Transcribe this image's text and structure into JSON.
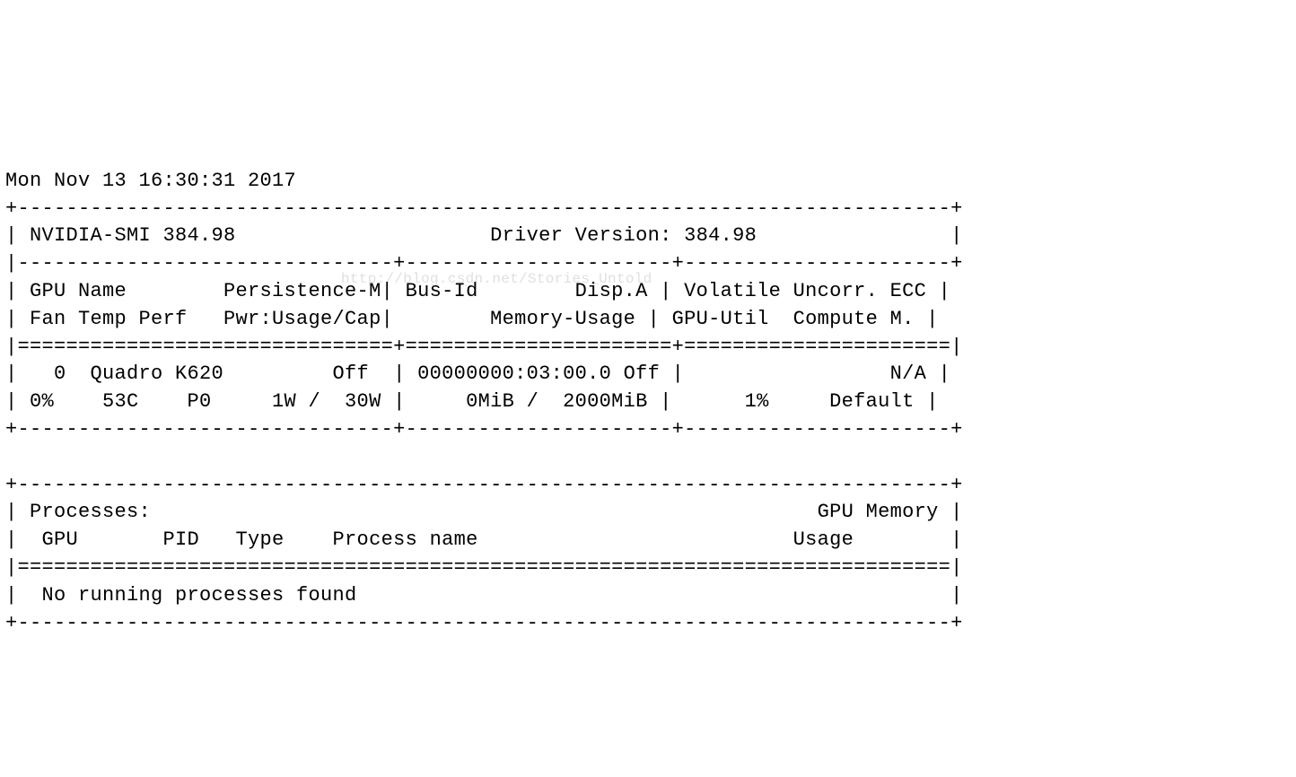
{
  "timestamp": "Mon Nov 13 16:30:31 2017",
  "smi_version_label": "NVIDIA-SMI",
  "smi_version": "384.98",
  "driver_version_label": "Driver Version:",
  "driver_version": "384.98",
  "headers": {
    "gpu": "GPU",
    "name": "Name",
    "persistence": "Persistence-M",
    "fan": "Fan",
    "temp": "Temp",
    "perf": "Perf",
    "pwr": "Pwr:Usage/Cap",
    "busid": "Bus-Id",
    "dispa": "Disp.A",
    "memusage": "Memory-Usage",
    "volatile": "Volatile",
    "uncorr": "Uncorr.",
    "ecc": "ECC",
    "gpuutil": "GPU-Util",
    "compute": "Compute M."
  },
  "gpus": [
    {
      "index": "0",
      "name": "Quadro K620",
      "persistence": "Off",
      "fan": "0%",
      "temp": "53C",
      "perf": "P0",
      "pwr_usage": "1W",
      "pwr_cap": "30W",
      "bus_id": "00000000:03:00.0",
      "disp_a": "Off",
      "mem_used": "0MiB",
      "mem_total": "2000MiB",
      "ecc": "N/A",
      "gpu_util": "1%",
      "compute_mode": "Default"
    }
  ],
  "processes": {
    "title": "Processes:",
    "gpu_memory_label": "GPU Memory",
    "usage_label": "Usage",
    "col_gpu": "GPU",
    "col_pid": "PID",
    "col_type": "Type",
    "col_process": "Process name",
    "none": "No running processes found"
  },
  "watermark": "http://blog.csdn.net/Stories_Untold"
}
